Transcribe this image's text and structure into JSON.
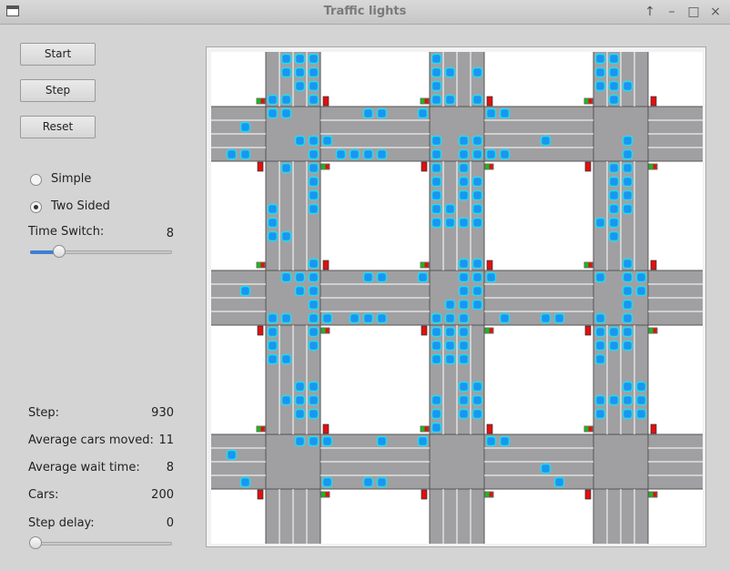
{
  "window": {
    "title": "Traffic lights",
    "controls": [
      "↑",
      "–",
      "□",
      "×"
    ]
  },
  "buttons": {
    "start": "Start",
    "step": "Step",
    "reset": "Reset"
  },
  "mode": {
    "simple": "Simple",
    "two_sided": "Two Sided",
    "selected": "two_sided"
  },
  "time_switch": {
    "label": "Time Switch:",
    "value": "8",
    "level": 0.18
  },
  "stats": {
    "step_label": "Step:",
    "step_value": "930",
    "avg_moved_label": "Average cars moved:",
    "avg_moved_value": "11",
    "avg_wait_label": "Average wait time:",
    "avg_wait_value": "8",
    "cars_label": "Cars:",
    "cars_value": "200"
  },
  "step_delay": {
    "label": "Step delay:",
    "value": "0",
    "level": 0
  },
  "colors": {
    "road": "#a0a0a3",
    "block": "#ffffff",
    "lane_line": "#ffffff",
    "car": "#1a96f0",
    "car_outline": "#22dcf0",
    "light_red": "#e01010",
    "light_green": "#10c010",
    "slider_fill": "#3f7fd1"
  },
  "simulation": {
    "grid": 3,
    "signals": [
      {
        "at": [
          0,
          0
        ],
        "ns": "green"
      },
      {
        "at": [
          1,
          0
        ],
        "ns": "green"
      },
      {
        "at": [
          2,
          0
        ],
        "ns": "green"
      },
      {
        "at": [
          0,
          1
        ],
        "ns": "green"
      },
      {
        "at": [
          1,
          1
        ],
        "ns": "green"
      },
      {
        "at": [
          2,
          1
        ],
        "ns": "green"
      },
      {
        "at": [
          0,
          2
        ],
        "ns": "green"
      },
      {
        "at": [
          1,
          2
        ],
        "ns": "green"
      },
      {
        "at": [
          2,
          2
        ],
        "ns": "green"
      }
    ],
    "cars_vertical": [
      {
        "road": 0,
        "lane": 3,
        "row": 0
      },
      {
        "road": 0,
        "lane": 3,
        "row": 1
      },
      {
        "road": 0,
        "lane": 3,
        "row": 2
      },
      {
        "road": 0,
        "lane": 3,
        "row": 3
      },
      {
        "road": 0,
        "lane": 1,
        "row": 0
      },
      {
        "road": 0,
        "lane": 1,
        "row": 1
      },
      {
        "road": 0,
        "lane": 1,
        "row": 3
      },
      {
        "road": 0,
        "lane": 1,
        "row": 4
      },
      {
        "road": 0,
        "lane": 2,
        "row": 0
      },
      {
        "road": 0,
        "lane": 2,
        "row": 1
      },
      {
        "road": 0,
        "lane": 2,
        "row": 2
      },
      {
        "road": 0,
        "lane": 0,
        "row": 3
      },
      {
        "road": 0,
        "lane": 0,
        "row": 4
      },
      {
        "road": 1,
        "lane": 0,
        "row": 0
      },
      {
        "road": 1,
        "lane": 0,
        "row": 1
      },
      {
        "road": 1,
        "lane": 0,
        "row": 2
      },
      {
        "road": 1,
        "lane": 0,
        "row": 3
      },
      {
        "road": 1,
        "lane": 1,
        "row": 1
      },
      {
        "road": 1,
        "lane": 1,
        "row": 3
      },
      {
        "road": 1,
        "lane": 3,
        "row": 1
      },
      {
        "road": 1,
        "lane": 3,
        "row": 3
      },
      {
        "road": 2,
        "lane": 0,
        "row": 0
      },
      {
        "road": 2,
        "lane": 0,
        "row": 1
      },
      {
        "road": 2,
        "lane": 0,
        "row": 2
      },
      {
        "road": 2,
        "lane": 1,
        "row": 0
      },
      {
        "road": 2,
        "lane": 1,
        "row": 1
      },
      {
        "road": 2,
        "lane": 1,
        "row": 2
      },
      {
        "road": 2,
        "lane": 1,
        "row": 3
      },
      {
        "road": 2,
        "lane": 2,
        "row": 2
      },
      {
        "road": 0,
        "lane": 3,
        "row": 6
      },
      {
        "road": 0,
        "lane": 3,
        "row": 7
      },
      {
        "road": 0,
        "lane": 3,
        "row": 8
      },
      {
        "road": 0,
        "lane": 3,
        "row": 9
      },
      {
        "road": 0,
        "lane": 3,
        "row": 10
      },
      {
        "road": 0,
        "lane": 3,
        "row": 11
      },
      {
        "road": 0,
        "lane": 2,
        "row": 6
      },
      {
        "road": 0,
        "lane": 1,
        "row": 8
      },
      {
        "road": 0,
        "lane": 0,
        "row": 11
      },
      {
        "road": 0,
        "lane": 0,
        "row": 12
      },
      {
        "road": 0,
        "lane": 0,
        "row": 13
      },
      {
        "road": 0,
        "lane": 1,
        "row": 13
      },
      {
        "road": 1,
        "lane": 0,
        "row": 7
      },
      {
        "road": 1,
        "lane": 0,
        "row": 8
      },
      {
        "road": 1,
        "lane": 0,
        "row": 9
      },
      {
        "road": 1,
        "lane": 0,
        "row": 10
      },
      {
        "road": 1,
        "lane": 0,
        "row": 11
      },
      {
        "road": 1,
        "lane": 0,
        "row": 12
      },
      {
        "road": 1,
        "lane": 2,
        "row": 6
      },
      {
        "road": 1,
        "lane": 2,
        "row": 7
      },
      {
        "road": 1,
        "lane": 2,
        "row": 8
      },
      {
        "road": 1,
        "lane": 2,
        "row": 9
      },
      {
        "road": 1,
        "lane": 2,
        "row": 10
      },
      {
        "road": 1,
        "lane": 3,
        "row": 6
      },
      {
        "road": 1,
        "lane": 3,
        "row": 7
      },
      {
        "road": 1,
        "lane": 3,
        "row": 9
      },
      {
        "road": 1,
        "lane": 3,
        "row": 10
      },
      {
        "road": 1,
        "lane": 3,
        "row": 11
      },
      {
        "road": 1,
        "lane": 3,
        "row": 12
      },
      {
        "road": 1,
        "lane": 1,
        "row": 11
      },
      {
        "road": 1,
        "lane": 1,
        "row": 12
      },
      {
        "road": 1,
        "lane": 2,
        "row": 12
      },
      {
        "road": 2,
        "lane": 2,
        "row": 6
      },
      {
        "road": 2,
        "lane": 2,
        "row": 7
      },
      {
        "road": 2,
        "lane": 2,
        "row": 8
      },
      {
        "road": 2,
        "lane": 2,
        "row": 9
      },
      {
        "road": 2,
        "lane": 2,
        "row": 10
      },
      {
        "road": 2,
        "lane": 2,
        "row": 11
      },
      {
        "road": 2,
        "lane": 1,
        "row": 8
      },
      {
        "road": 2,
        "lane": 1,
        "row": 9
      },
      {
        "road": 2,
        "lane": 1,
        "row": 10
      },
      {
        "road": 2,
        "lane": 1,
        "row": 11
      },
      {
        "road": 2,
        "lane": 1,
        "row": 12
      },
      {
        "road": 2,
        "lane": 0,
        "row": 12
      },
      {
        "road": 2,
        "lane": 1,
        "row": 13
      },
      {
        "road": 0,
        "lane": 3,
        "row": 15
      },
      {
        "road": 0,
        "lane": 3,
        "row": 16
      },
      {
        "road": 0,
        "lane": 3,
        "row": 17
      },
      {
        "road": 0,
        "lane": 3,
        "row": 18
      },
      {
        "road": 0,
        "lane": 3,
        "row": 19
      },
      {
        "road": 0,
        "lane": 3,
        "row": 20
      },
      {
        "road": 0,
        "lane": 3,
        "row": 21
      },
      {
        "road": 0,
        "lane": 1,
        "row": 16
      },
      {
        "road": 0,
        "lane": 1,
        "row": 19
      },
      {
        "road": 0,
        "lane": 2,
        "row": 16
      },
      {
        "road": 0,
        "lane": 2,
        "row": 17
      },
      {
        "road": 0,
        "lane": 0,
        "row": 19
      },
      {
        "road": 0,
        "lane": 0,
        "row": 20
      },
      {
        "road": 0,
        "lane": 0,
        "row": 21
      },
      {
        "road": 0,
        "lane": 0,
        "row": 22
      },
      {
        "road": 0,
        "lane": 1,
        "row": 22
      },
      {
        "road": 1,
        "lane": 0,
        "row": 19
      },
      {
        "road": 1,
        "lane": 0,
        "row": 20
      },
      {
        "road": 1,
        "lane": 0,
        "row": 21
      },
      {
        "road": 1,
        "lane": 0,
        "row": 22
      },
      {
        "road": 1,
        "lane": 1,
        "row": 18
      },
      {
        "road": 1,
        "lane": 1,
        "row": 19
      },
      {
        "road": 1,
        "lane": 1,
        "row": 20
      },
      {
        "road": 1,
        "lane": 1,
        "row": 21
      },
      {
        "road": 1,
        "lane": 1,
        "row": 22
      },
      {
        "road": 1,
        "lane": 2,
        "row": 15
      },
      {
        "road": 1,
        "lane": 2,
        "row": 16
      },
      {
        "road": 1,
        "lane": 2,
        "row": 17
      },
      {
        "road": 1,
        "lane": 2,
        "row": 18
      },
      {
        "road": 1,
        "lane": 2,
        "row": 19
      },
      {
        "road": 1,
        "lane": 2,
        "row": 20
      },
      {
        "road": 1,
        "lane": 2,
        "row": 21
      },
      {
        "road": 1,
        "lane": 2,
        "row": 22
      },
      {
        "road": 1,
        "lane": 3,
        "row": 15
      },
      {
        "road": 1,
        "lane": 3,
        "row": 16
      },
      {
        "road": 1,
        "lane": 3,
        "row": 17
      },
      {
        "road": 1,
        "lane": 3,
        "row": 18
      },
      {
        "road": 2,
        "lane": 0,
        "row": 16
      },
      {
        "road": 2,
        "lane": 0,
        "row": 19
      },
      {
        "road": 2,
        "lane": 0,
        "row": 20
      },
      {
        "road": 2,
        "lane": 0,
        "row": 21
      },
      {
        "road": 2,
        "lane": 0,
        "row": 22
      },
      {
        "road": 2,
        "lane": 1,
        "row": 20
      },
      {
        "road": 2,
        "lane": 1,
        "row": 21
      },
      {
        "road": 2,
        "lane": 2,
        "row": 15
      },
      {
        "road": 2,
        "lane": 2,
        "row": 16
      },
      {
        "road": 2,
        "lane": 2,
        "row": 17
      },
      {
        "road": 2,
        "lane": 2,
        "row": 18
      },
      {
        "road": 2,
        "lane": 2,
        "row": 19
      },
      {
        "road": 2,
        "lane": 2,
        "row": 20
      },
      {
        "road": 2,
        "lane": 2,
        "row": 21
      },
      {
        "road": 2,
        "lane": 3,
        "row": 16
      },
      {
        "road": 2,
        "lane": 3,
        "row": 17
      },
      {
        "road": 0,
        "lane": 1,
        "row": 25
      },
      {
        "road": 0,
        "lane": 2,
        "row": 24
      },
      {
        "road": 0,
        "lane": 2,
        "row": 25
      },
      {
        "road": 0,
        "lane": 2,
        "row": 26
      },
      {
        "road": 0,
        "lane": 3,
        "row": 24
      },
      {
        "road": 0,
        "lane": 3,
        "row": 25
      },
      {
        "road": 0,
        "lane": 3,
        "row": 26
      },
      {
        "road": 1,
        "lane": 0,
        "row": 25
      },
      {
        "road": 1,
        "lane": 0,
        "row": 26
      },
      {
        "road": 1,
        "lane": 0,
        "row": 27
      },
      {
        "road": 1,
        "lane": 2,
        "row": 24
      },
      {
        "road": 1,
        "lane": 2,
        "row": 25
      },
      {
        "road": 1,
        "lane": 2,
        "row": 26
      },
      {
        "road": 1,
        "lane": 3,
        "row": 24
      },
      {
        "road": 1,
        "lane": 3,
        "row": 25
      },
      {
        "road": 1,
        "lane": 3,
        "row": 26
      },
      {
        "road": 2,
        "lane": 0,
        "row": 25
      },
      {
        "road": 2,
        "lane": 0,
        "row": 26
      },
      {
        "road": 2,
        "lane": 1,
        "row": 25
      },
      {
        "road": 2,
        "lane": 2,
        "row": 24
      },
      {
        "road": 2,
        "lane": 2,
        "row": 25
      },
      {
        "road": 2,
        "lane": 2,
        "row": 26
      },
      {
        "road": 2,
        "lane": 3,
        "row": 24
      },
      {
        "road": 2,
        "lane": 3,
        "row": 25
      },
      {
        "road": 2,
        "lane": 3,
        "row": 26
      }
    ],
    "cars_horizontal": [
      {
        "road": 0,
        "lane": 0,
        "col": 11
      },
      {
        "road": 0,
        "lane": 0,
        "col": 12
      },
      {
        "road": 0,
        "lane": 0,
        "col": 15
      },
      {
        "road": 0,
        "lane": 0,
        "col": 20
      },
      {
        "road": 0,
        "lane": 0,
        "col": 21
      },
      {
        "road": 0,
        "lane": 1,
        "col": 2
      },
      {
        "road": 0,
        "lane": 2,
        "col": 8
      },
      {
        "road": 0,
        "lane": 2,
        "col": 16
      },
      {
        "road": 0,
        "lane": 2,
        "col": 24
      },
      {
        "road": 0,
        "lane": 3,
        "col": 1
      },
      {
        "road": 0,
        "lane": 3,
        "col": 2
      },
      {
        "road": 0,
        "lane": 3,
        "col": 9
      },
      {
        "road": 0,
        "lane": 3,
        "col": 10
      },
      {
        "road": 0,
        "lane": 3,
        "col": 11
      },
      {
        "road": 0,
        "lane": 3,
        "col": 12
      },
      {
        "road": 0,
        "lane": 3,
        "col": 19
      },
      {
        "road": 0,
        "lane": 3,
        "col": 20
      },
      {
        "road": 0,
        "lane": 3,
        "col": 21
      },
      {
        "road": 1,
        "lane": 0,
        "col": 11
      },
      {
        "road": 1,
        "lane": 0,
        "col": 12
      },
      {
        "road": 1,
        "lane": 0,
        "col": 15
      },
      {
        "road": 1,
        "lane": 0,
        "col": 20
      },
      {
        "road": 1,
        "lane": 1,
        "col": 2
      },
      {
        "road": 1,
        "lane": 3,
        "col": 7
      },
      {
        "road": 1,
        "lane": 3,
        "col": 8
      },
      {
        "road": 1,
        "lane": 3,
        "col": 10
      },
      {
        "road": 1,
        "lane": 3,
        "col": 11
      },
      {
        "road": 1,
        "lane": 3,
        "col": 12
      },
      {
        "road": 1,
        "lane": 3,
        "col": 16
      },
      {
        "road": 1,
        "lane": 3,
        "col": 21
      },
      {
        "road": 1,
        "lane": 3,
        "col": 24
      },
      {
        "road": 1,
        "lane": 3,
        "col": 25
      },
      {
        "road": 2,
        "lane": 0,
        "col": 6
      },
      {
        "road": 2,
        "lane": 0,
        "col": 7
      },
      {
        "road": 2,
        "lane": 0,
        "col": 8
      },
      {
        "road": 2,
        "lane": 0,
        "col": 12
      },
      {
        "road": 2,
        "lane": 0,
        "col": 15
      },
      {
        "road": 2,
        "lane": 0,
        "col": 20
      },
      {
        "road": 2,
        "lane": 0,
        "col": 21
      },
      {
        "road": 2,
        "lane": 1,
        "col": 1
      },
      {
        "road": 2,
        "lane": 2,
        "col": 24
      },
      {
        "road": 2,
        "lane": 3,
        "col": 2
      },
      {
        "road": 2,
        "lane": 3,
        "col": 8
      },
      {
        "road": 2,
        "lane": 3,
        "col": 11
      },
      {
        "road": 2,
        "lane": 3,
        "col": 12
      },
      {
        "road": 2,
        "lane": 3,
        "col": 25
      }
    ]
  }
}
